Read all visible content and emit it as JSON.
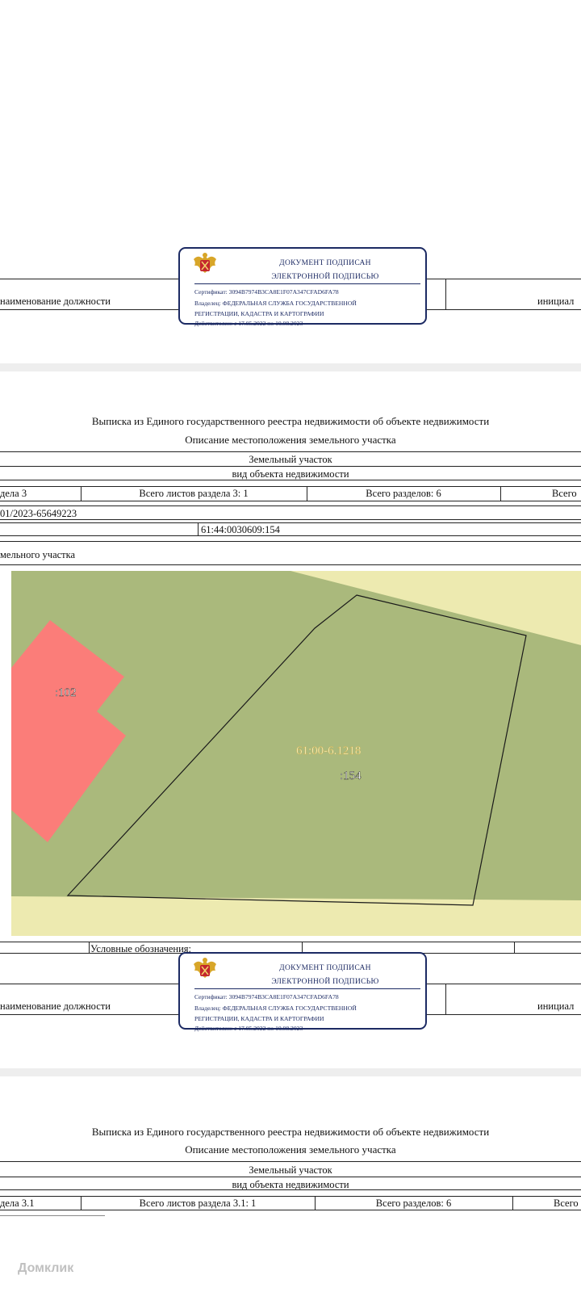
{
  "stamp": {
    "line1": "ДОКУМЕНТ ПОДПИСАН",
    "line2": "ЭЛЕКТРОННОЙ ПОДПИСЬЮ",
    "certificate": "Сертификат: 3094B7974B3CA8E1F07A347CFAD6FA78",
    "owner": "Владелец: ФЕДЕРАЛЬНАЯ СЛУЖБА ГОСУДАРСТВЕННОЙ",
    "owner_cont": "РЕГИСТРАЦИИ, КАДАСТРА И КАРТОГРАФИИ",
    "valid": "Действителен: с 17.05.2022 по 10.08.2023"
  },
  "footer": {
    "position_label": "наименование должности",
    "initials_label": "инициал"
  },
  "extract": {
    "title": "Выписка из Единого государственного реестра недвижимости об объекте недвижимости",
    "subtitle": "Описание местоположения земельного участка",
    "object_type": "Земельный участок",
    "object_type_caption": "вид объекта недвижимости"
  },
  "page1": {
    "section": "дела 3",
    "sheets": "Всего листов раздела 3: 1",
    "sections_total": "Всего разделов: 6",
    "sheets_total_cut": "Всего",
    "record_number": "01/2023-65649223",
    "cadastral_number": "61:44:0030609:154",
    "plan_caption": "мельного участка",
    "legend_label": "Условные обозначения:"
  },
  "map": {
    "labels": {
      "neighbor": ":102",
      "quarter": "61:00-6.1218",
      "parcel": ":154"
    },
    "colors": {
      "background": "#edeab0",
      "territory": "#aab97c",
      "neighbor_parcel": "#fb7d79"
    }
  },
  "page2": {
    "section": "дела 3.1",
    "sheets": "Всего листов раздела 3.1: 1",
    "sections_total": "Всего разделов: 6",
    "sheets_total_cut": "Всего"
  },
  "watermark": "Домклик"
}
